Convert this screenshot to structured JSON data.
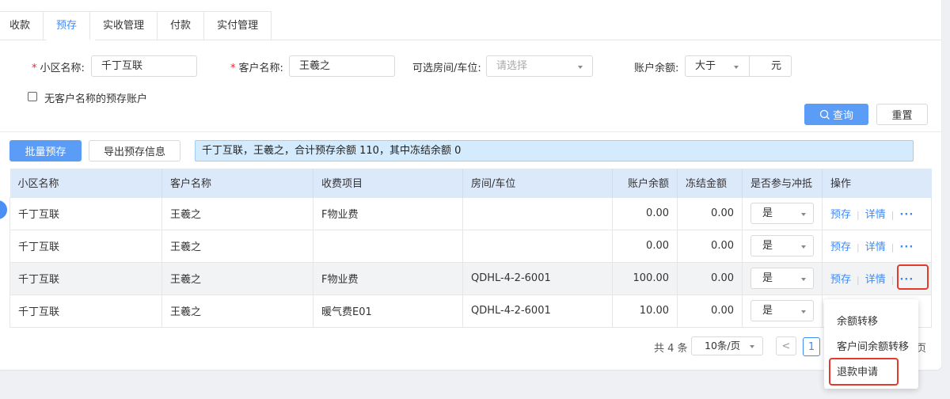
{
  "tabs": [
    "收款",
    "预存",
    "实收管理",
    "付款",
    "实付管理"
  ],
  "active_tab": 1,
  "filters": {
    "community_label": "小区名称:",
    "community_value": "千丁互联",
    "customer_label": "客户名称:",
    "customer_value": "王羲之",
    "room_label": "可选房间/车位:",
    "room_placeholder": "请选择",
    "balance_label": "账户余额:",
    "balance_op": "大于",
    "balance_unit": "元",
    "no_name_checkbox": "无客户名称的预存账户",
    "query_button": "查询",
    "reset_button": "重置"
  },
  "toolbar": {
    "batch_button": "批量预存",
    "export_button": "导出预存信息",
    "summary": "千丁互联，王羲之，合计预存余额 110，其中冻结余额 0"
  },
  "table": {
    "headers": [
      "小区名称",
      "客户名称",
      "收费项目",
      "房间/车位",
      "账户余额",
      "冻结金额",
      "是否参与冲抵",
      "操作"
    ],
    "rows": [
      {
        "community": "千丁互联",
        "customer": "王羲之",
        "item": "F物业费",
        "room": "",
        "balance": "0.00",
        "frozen": "0.00",
        "offset": "是"
      },
      {
        "community": "千丁互联",
        "customer": "王羲之",
        "item": "",
        "room": "",
        "balance": "0.00",
        "frozen": "0.00",
        "offset": "是"
      },
      {
        "community": "千丁互联",
        "customer": "王羲之",
        "item": "F物业费",
        "room": "QDHL-4-2-6001",
        "balance": "100.00",
        "frozen": "0.00",
        "offset": "是"
      },
      {
        "community": "千丁互联",
        "customer": "王羲之",
        "item": "暖气费E01",
        "room": "QDHL-4-2-6001",
        "balance": "10.00",
        "frozen": "0.00",
        "offset": "是"
      }
    ],
    "action_prestore": "预存",
    "action_detail": "详情",
    "action_more": "···"
  },
  "menu": {
    "items": [
      "余额转移",
      "客户间余额转移",
      "退款申请"
    ]
  },
  "pager": {
    "total": "共 4 条",
    "page_size": "10条/页",
    "current_page": "1",
    "prev": "<",
    "tail": "页"
  },
  "colors": {
    "primary": "#3d8af7",
    "highlight_border": "#e43a2c",
    "summary_bg": "#d3ebfd",
    "header_bg": "#dce9fb"
  }
}
